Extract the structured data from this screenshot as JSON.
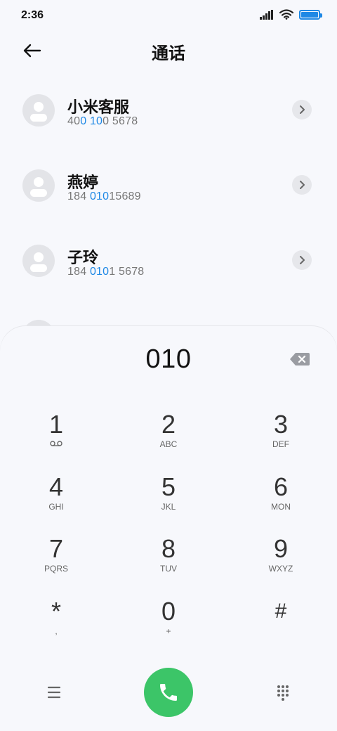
{
  "status_bar": {
    "time": "2:36"
  },
  "header": {
    "title": "通话"
  },
  "contacts": [
    {
      "name": "小米客服",
      "number_parts": [
        "40",
        "0 10",
        "0 5678"
      ]
    },
    {
      "name": "燕婷",
      "number_parts": [
        "184 ",
        "010",
        "15689"
      ]
    },
    {
      "name": "子玲",
      "number_parts": [
        "184 ",
        "010",
        "1 5678"
      ]
    }
  ],
  "dialer": {
    "input": "010",
    "keys": [
      {
        "digit": "1",
        "letters": ""
      },
      {
        "digit": "2",
        "letters": "ABC"
      },
      {
        "digit": "3",
        "letters": "DEF"
      },
      {
        "digit": "4",
        "letters": "GHI"
      },
      {
        "digit": "5",
        "letters": "JKL"
      },
      {
        "digit": "6",
        "letters": "MON"
      },
      {
        "digit": "7",
        "letters": "PQRS"
      },
      {
        "digit": "8",
        "letters": "TUV"
      },
      {
        "digit": "9",
        "letters": "WXYZ"
      },
      {
        "digit": "*",
        "letters": ","
      },
      {
        "digit": "0",
        "letters": "+"
      },
      {
        "digit": "#",
        "letters": ""
      }
    ]
  },
  "colors": {
    "accent": "#1e88e5",
    "call_button": "#3cc568"
  },
  "icons": [
    "back-arrow-icon",
    "chevron-right-icon",
    "backspace-icon",
    "voicemail-icon",
    "menu-icon",
    "phone-icon",
    "dialpad-icon",
    "signal-icon",
    "wifi-icon",
    "battery-icon"
  ]
}
